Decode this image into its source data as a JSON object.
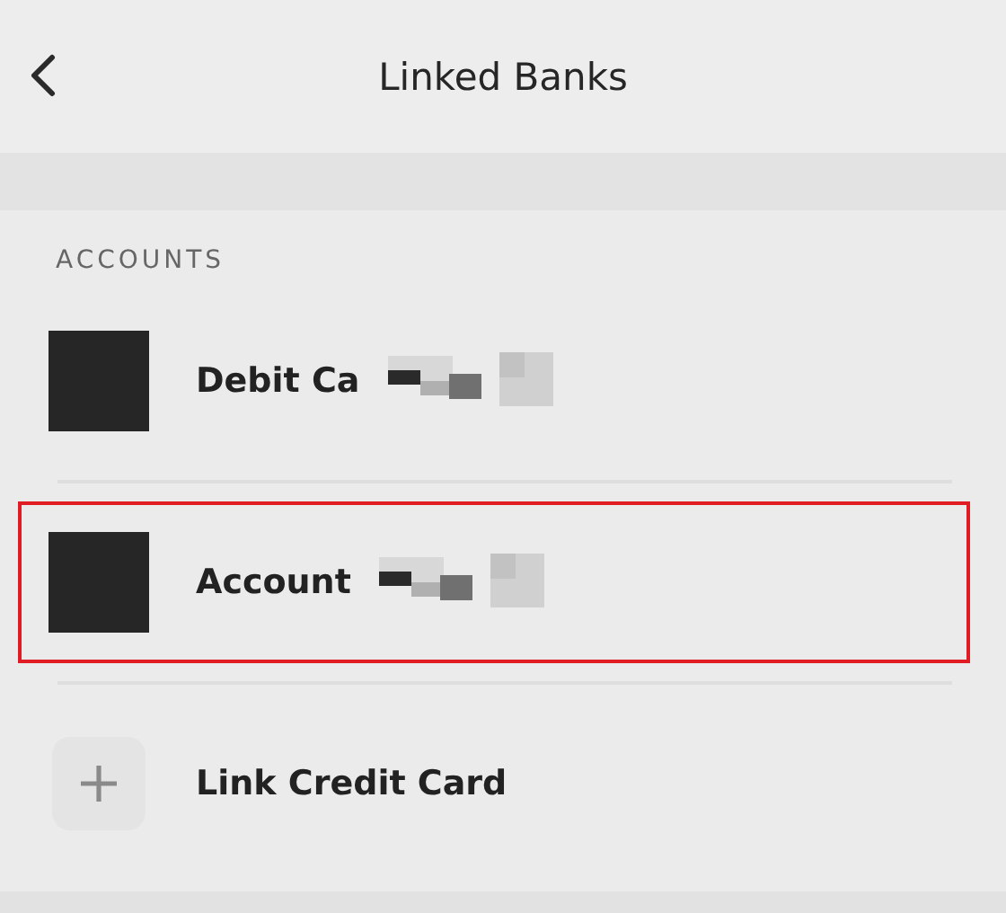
{
  "header": {
    "title": "Linked Banks"
  },
  "section": {
    "heading": "ACCOUNTS"
  },
  "items": [
    {
      "kind": "bank",
      "label": "Debit Ca",
      "redacted": true,
      "highlighted": false
    },
    {
      "kind": "bank",
      "label": "Account",
      "redacted": true,
      "highlighted": true
    },
    {
      "kind": "add",
      "label": "Link Credit Card",
      "redacted": false,
      "highlighted": false
    }
  ]
}
